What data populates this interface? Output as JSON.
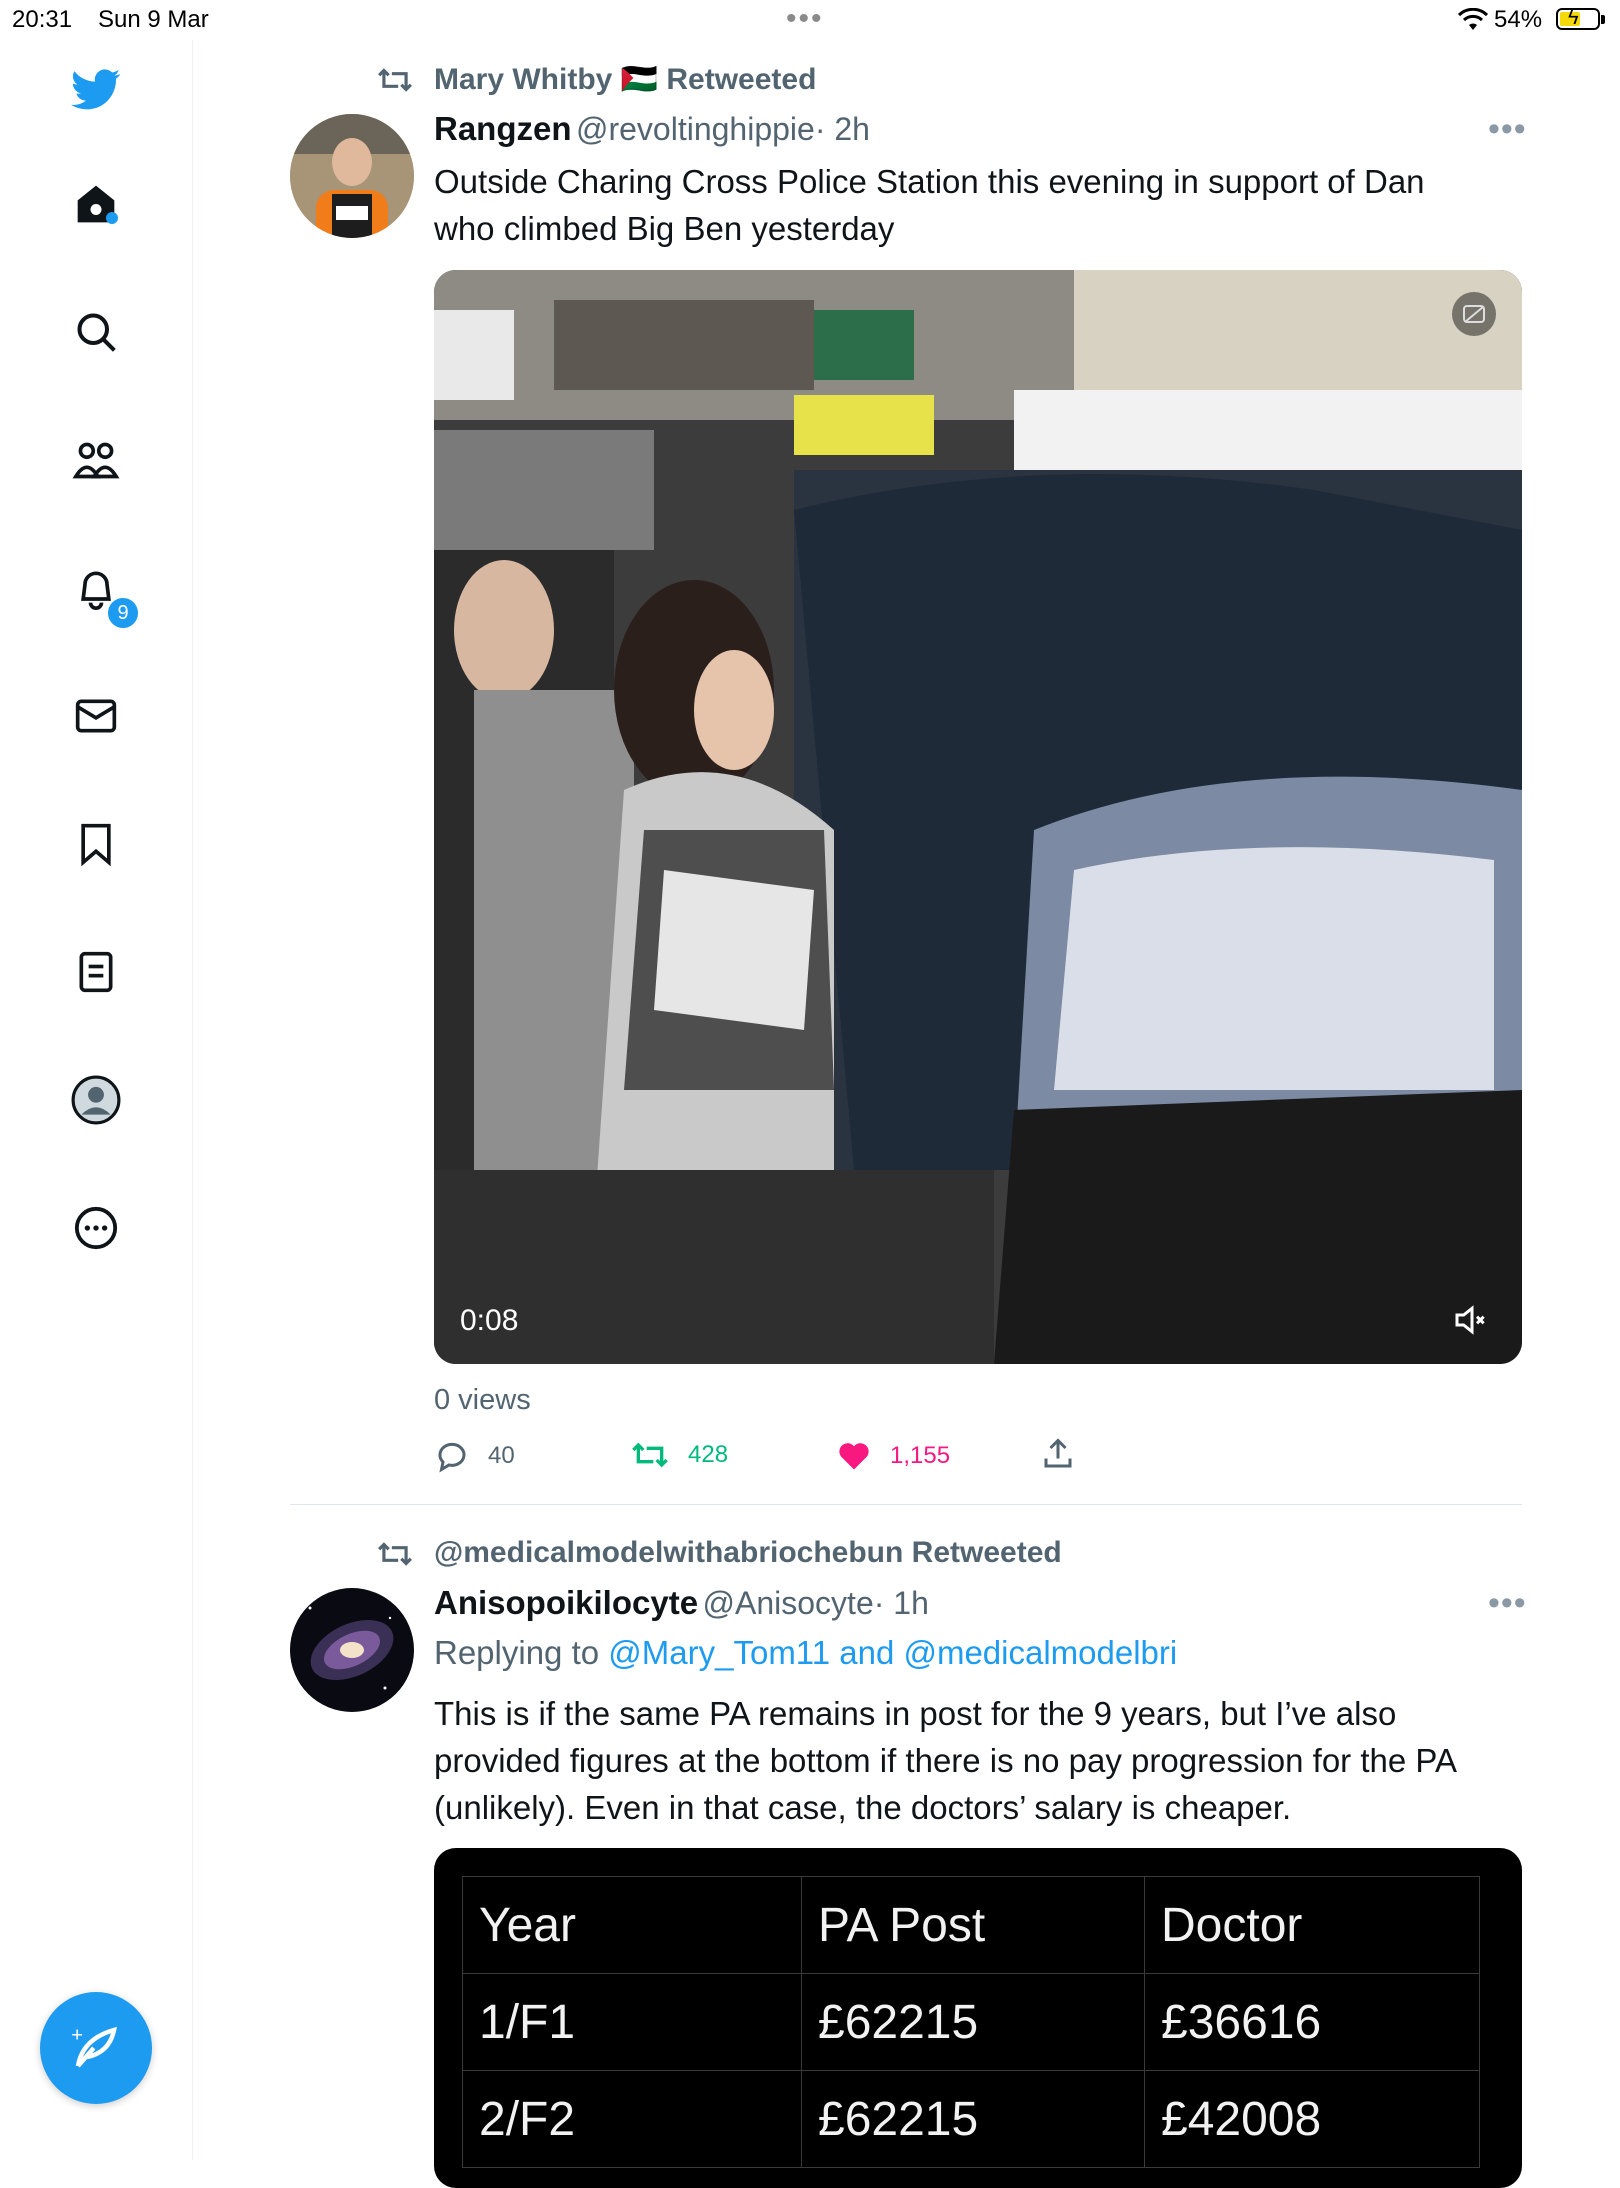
{
  "status_bar": {
    "time": "20:31",
    "date": "Sun 9 Mar",
    "battery": "54%"
  },
  "sidebar": {
    "notifications_badge": "9",
    "icons": [
      "twitter-bird-icon",
      "home-icon",
      "search-icon",
      "communities-icon",
      "notifications-icon",
      "messages-icon",
      "bookmarks-icon",
      "lists-icon",
      "profile-icon",
      "more-icon"
    ]
  },
  "tweets": [
    {
      "retweeted_by": "Mary Whitby 🇵🇸 Retweeted",
      "name": "Rangzen",
      "handle": "@revoltinghippie",
      "time": "· 2h",
      "text_lines": [
        "Outside Charing Cross Police Station this evening in support of Dan",
        "who climbed Big Ben yesterday"
      ],
      "video_time": "0:08",
      "views": "0 views",
      "replies": "40",
      "retweets": "428",
      "likes": "1,155"
    },
    {
      "retweeted_by": "@medicalmodelwithabriochebun Retweeted",
      "name": "Anisopoikilocyte",
      "handle": "@Anisocyte",
      "time": "· 1h",
      "replying_prefix": "Replying to",
      "replying_to": "@Mary_Tom11 and @medicalmodelbri",
      "text_lines": [
        "This is if the same PA remains in post for the 9 years, but I’ve also",
        "provided figures at the bottom if there is no pay progression for the PA",
        "(unlikely). Even in that case, the doctors’ salary is cheaper."
      ],
      "table": {
        "headers": [
          "Year",
          "PA Post",
          "Doctor"
        ],
        "rows": [
          [
            "1/F1",
            "£62215",
            "£36616"
          ],
          [
            "2/F2",
            "£62215",
            "£42008"
          ]
        ]
      }
    }
  ],
  "colors": {
    "accent": "#1d9bf0",
    "retweet_green": "#00ba7c",
    "like_pink": "#f91880",
    "muted": "#536471"
  }
}
